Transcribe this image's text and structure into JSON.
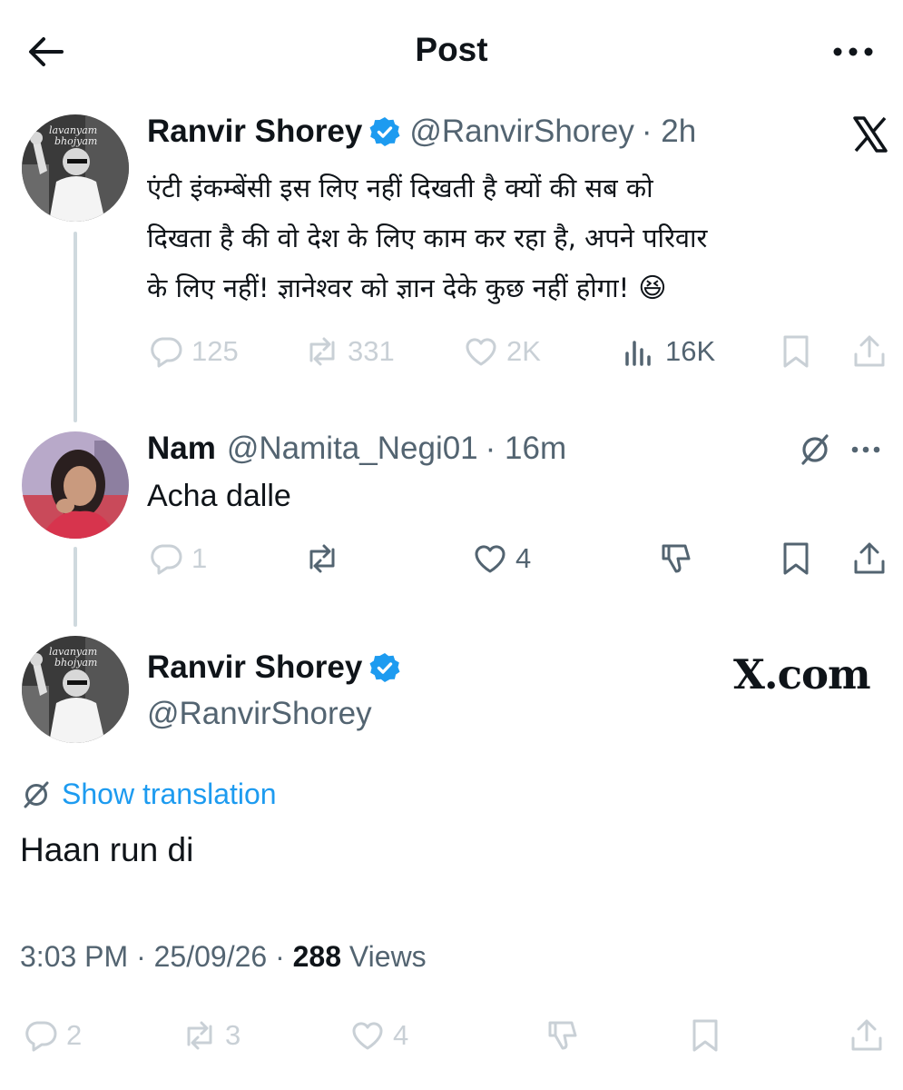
{
  "header": {
    "title": "Post"
  },
  "main_tweet": {
    "display_name": "Ranvir Shorey",
    "handle": "@RanvirShorey",
    "time": "· 2h",
    "avatar_text_1": "lavanyam",
    "avatar_text_2": "bhojyam",
    "text_line_1": "एंटी इंकम्बेंसी इस लिए नहीं दिखती है क्यों की सब को",
    "text_line_2": "दिखता है की वो देश के लिए काम कर रहा है, अपने परिवार",
    "text_line_3": "के लिए नहीं! ज्ञानेश्वर को ज्ञान देके कुछ नहीं होगा!",
    "emoji": "😆",
    "replies": "125",
    "reposts": "331",
    "likes": "2K",
    "views": "16K"
  },
  "reply_tweet": {
    "display_name": "Nam",
    "handle": "@Namita_Negi01",
    "time": "· 16m",
    "text": "Acha dalle",
    "replies": "1",
    "likes": "4"
  },
  "focused_tweet": {
    "display_name": "Ranvir Shorey",
    "handle": "@RanvirShorey",
    "watermark": "X.com",
    "show_translation": "Show translation",
    "text": "Haan run di",
    "time": "3:03 PM · 25/09/26 · ",
    "views_count": "288",
    "views_label": " Views",
    "replies": "2",
    "reposts": "3",
    "likes": "4"
  },
  "colors": {
    "accent": "#1d9bf0",
    "muted": "#536471",
    "faded": "#c9d0d6",
    "line": "#cfd9de"
  },
  "icons": [
    "back-arrow-icon",
    "more-icon",
    "verified-badge-icon",
    "x-logo-icon",
    "reply-icon",
    "repost-icon",
    "like-icon",
    "views-icon",
    "bookmark-icon",
    "share-icon",
    "translate-icon",
    "dislike-icon"
  ]
}
